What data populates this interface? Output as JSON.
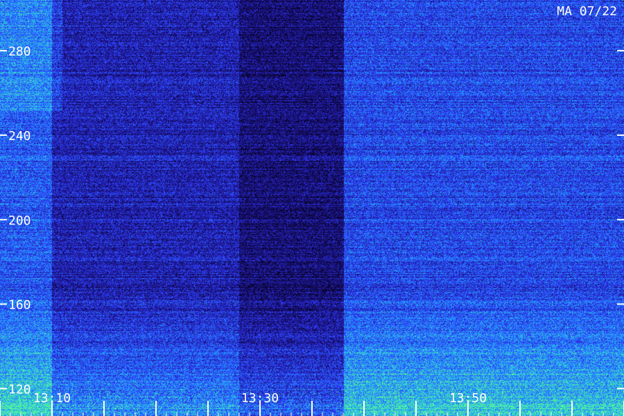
{
  "chart_data": {
    "type": "heatmap",
    "title": "",
    "stamp": "MA 07/22",
    "y_axis": {
      "ticks": [
        120,
        160,
        200,
        240,
        280
      ],
      "tick_labels": [
        "120",
        "160",
        "200",
        "240",
        "280"
      ],
      "range": [
        107,
        304
      ]
    },
    "x_axis": {
      "labeled_ticks": [
        "13:10",
        "13:30",
        "13:50"
      ],
      "range_minutes": [
        "13:05",
        "14:05"
      ],
      "major_tick_interval_minutes": 5,
      "minor_tick_interval_minutes": 1
    },
    "colormap": [
      "#05021a",
      "#1a0f7a",
      "#2f3cff",
      "#21a9ff",
      "#58ff8e"
    ],
    "intensity_regions": [
      {
        "from": "13:05",
        "to": "13:10",
        "level": 0.55
      },
      {
        "from": "13:10",
        "to": "13:28",
        "level": 0.35
      },
      {
        "from": "13:28",
        "to": "13:38",
        "level": 0.22
      },
      {
        "from": "13:38",
        "to": "14:05",
        "level": 0.5
      }
    ],
    "grid": false
  }
}
